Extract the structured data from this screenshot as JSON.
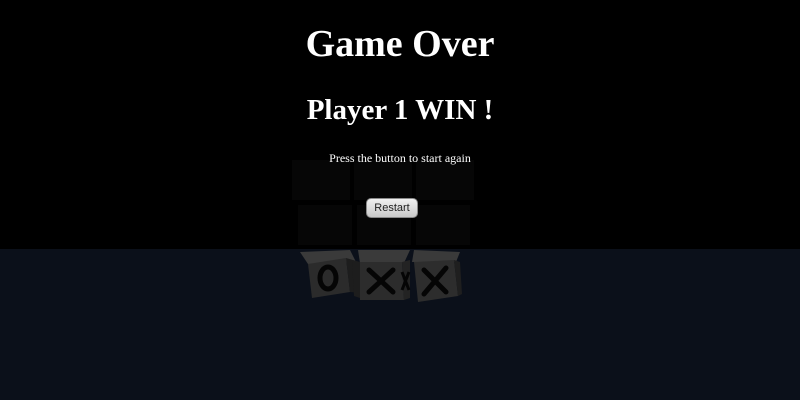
{
  "overlay": {
    "title": "Game Over",
    "result": "Player 1 WIN !",
    "instruction": "Press the button to start again",
    "restart_label": "Restart"
  },
  "board": {
    "visible_front_row": [
      "O",
      "X",
      "X"
    ],
    "colors": {
      "cube_face": "#2c2c2c",
      "cube_top": "#3a3a3a",
      "cube_side": "#1e1e1e",
      "mark": "#050505",
      "background_top": "#000000",
      "background_bottom": "#0b101a"
    }
  }
}
